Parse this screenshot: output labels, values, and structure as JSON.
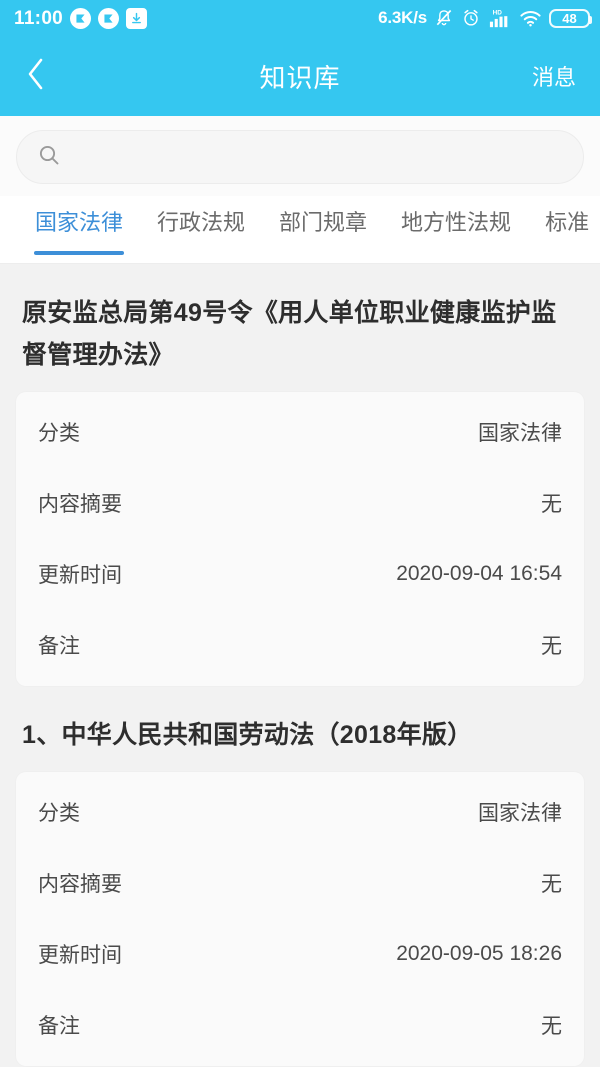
{
  "theme": {
    "accent": "#35c7f0",
    "tab_active": "#3d8fd8",
    "page_bg": "#f2f2f2",
    "card_bg": "#fafafa"
  },
  "statusbar": {
    "time": "11:00",
    "icons_left": [
      "app-badge-icon",
      "app-badge-icon",
      "download-icon"
    ],
    "network_speed": "6.3K/s",
    "icons_right": [
      "bell-muted-icon",
      "alarm-clock-icon",
      "hd-signal-icon",
      "wifi-icon"
    ],
    "battery_level": "48"
  },
  "navbar": {
    "back_icon": "chevron-left-icon",
    "title": "知识库",
    "action_label": "消息"
  },
  "search": {
    "icon": "search-icon",
    "value": "",
    "placeholder": ""
  },
  "tabs": [
    {
      "label": "国家法律",
      "active": true
    },
    {
      "label": "行政法规",
      "active": false
    },
    {
      "label": "部门规章",
      "active": false
    },
    {
      "label": "地方性法规",
      "active": false
    },
    {
      "label": "标准",
      "active": false
    }
  ],
  "documents": [
    {
      "title": "原安监总局第49号令《用人单位职业健康监护监督管理办法》",
      "rows": [
        {
          "key": "分类",
          "value": "国家法律"
        },
        {
          "key": "内容摘要",
          "value": "无"
        },
        {
          "key": "更新时间",
          "value": "2020-09-04 16:54"
        },
        {
          "key": "备注",
          "value": "无"
        }
      ]
    },
    {
      "title": "1、中华人民共和国劳动法（2018年版）",
      "rows": [
        {
          "key": "分类",
          "value": "国家法律"
        },
        {
          "key": "内容摘要",
          "value": "无"
        },
        {
          "key": "更新时间",
          "value": "2020-09-05 18:26"
        },
        {
          "key": "备注",
          "value": "无"
        }
      ]
    }
  ]
}
